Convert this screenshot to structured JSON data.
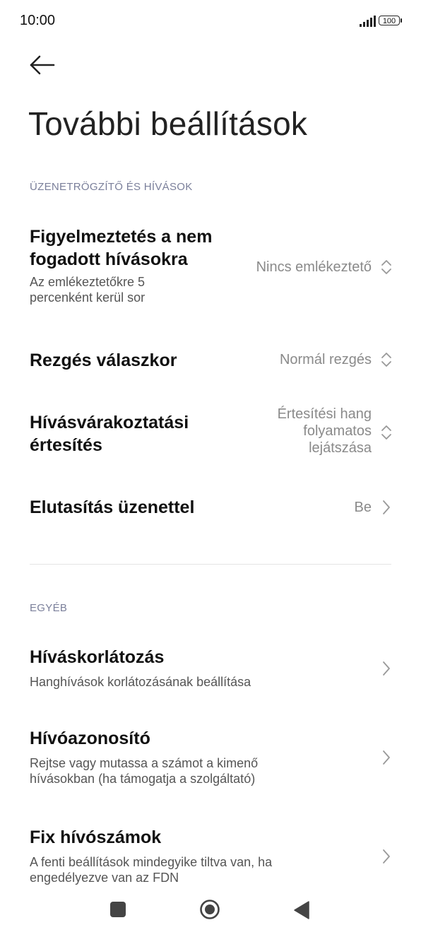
{
  "status_bar": {
    "time": "10:00",
    "battery": "100"
  },
  "header": {
    "title": "További beállítások"
  },
  "sections": [
    {
      "header": "ÜZENETRÖGZÍTŐ ÉS HÍVÁSOK",
      "items": [
        {
          "title": "Figyelmeztetés a nem fogadott hívásokra",
          "subtitle": "Az emlékeztetőkre 5 percenként kerül sor",
          "value": "Nincs emlékeztető",
          "control": "updown-icon"
        },
        {
          "title": "Rezgés válaszkor",
          "value": "Normál rezgés",
          "control": "updown-icon"
        },
        {
          "title": "Hívásvárakoztatási értesítés",
          "value": "Értesítési hang folyamatos lejátszása",
          "control": "updown-icon"
        },
        {
          "title": "Elutasítás üzenettel",
          "value": "Be",
          "control": "chevron-right-icon"
        }
      ]
    },
    {
      "header": "EGYÉB",
      "items": [
        {
          "title": "Híváskorlátozás",
          "subtitle": "Hanghívások korlátozásának beállítása",
          "control": "chevron-right-icon"
        },
        {
          "title": "Hívóazonosító",
          "subtitle": "Rejtse vagy mutassa a számot a kimenő hívásokban (ha támogatja a szolgáltató)",
          "control": "chevron-right-icon"
        },
        {
          "title": "Fix hívószámok",
          "subtitle": "A fenti beállítások mindegyike tiltva van, ha engedélyezve van az FDN",
          "control": "chevron-right-icon"
        }
      ]
    }
  ],
  "nav_bar": {
    "recents": "square-icon",
    "home": "circle-icon",
    "back": "triangle-back-icon"
  },
  "colors": {
    "section_header": "#7a7f9a",
    "value_text": "#8a8a8a",
    "title_text": "#111111"
  }
}
